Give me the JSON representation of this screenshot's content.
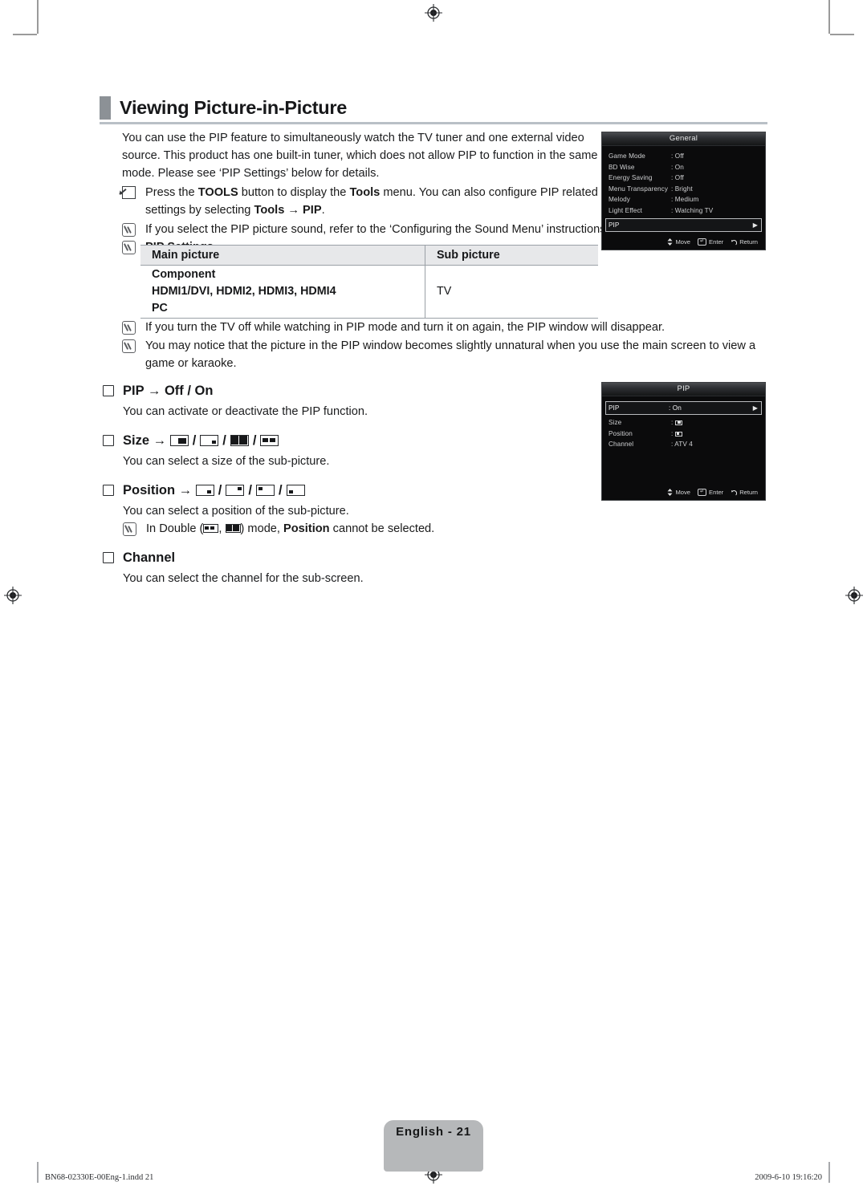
{
  "page": {
    "heading": "Viewing Picture-in-Picture",
    "footer_left": "BN68-02330E-00Eng-1.indd   21",
    "footer_right": "2009-6-10   19:16:20",
    "page_tab": "English - 21",
    "accent_bar_color": "#8c9196",
    "rule_color": "#b9c0c6"
  },
  "intro": {
    "paragraph": "You can use the PIP feature to simultaneously watch the TV tuner and one external video source. This product has one built-in tuner, which does not allow PIP to function in the same mode. Please see ‘PIP Settings’ below for details.",
    "tools_note_a": "Press the ",
    "tools_note_bold1": "TOOLS",
    "tools_note_b": " button to display the ",
    "tools_note_bold2": "Tools",
    "tools_note_c": " menu. You can also configure PIP related settings by selecting ",
    "tools_note_bold3": "Tools",
    "tools_note_arrow": " → ",
    "tools_note_bold4": "PIP",
    "tools_note_d": ".",
    "sound_note": "If you select the PIP picture sound, refer to the ‘Configuring the Sound Menu’ instructions.",
    "settings_note": "PIP Settings"
  },
  "pip_table": {
    "headers": [
      "Main picture",
      "Sub picture"
    ],
    "main_rows": [
      "Component",
      "HDMI1/DVI, HDMI2, HDMI3, HDMI4",
      "PC"
    ],
    "sub_value": "TV"
  },
  "post_table_notes": [
    "If you turn the TV off while watching in PIP mode and turn it on again, the PIP window will disappear.",
    "You may notice that the picture in the PIP window becomes slightly unnatural when you use the main screen to view a game or karaoke."
  ],
  "options": {
    "pip": {
      "title_a": "PIP",
      "title_arrow": " → ",
      "title_b": "Off / On",
      "desc": "You can activate or deactivate the PIP function."
    },
    "size": {
      "title": "Size",
      "title_arrow": " → ",
      "desc": "You can select a size of the sub-picture.",
      "glyph_names": [
        "size-large-icon",
        "size-small-icon",
        "size-double-wide-icon",
        "size-double-narrow-icon"
      ],
      "separator": "/"
    },
    "position": {
      "title": "Position",
      "title_arrow": " → ",
      "desc": "You can select a position of the sub-picture.",
      "glyph_names": [
        "position-bottom-right-icon",
        "position-top-right-icon",
        "position-top-left-icon",
        "position-bottom-left-icon"
      ],
      "separator": "/",
      "note_a": "In Double (",
      "note_comma": ", ",
      "note_b": ") mode, ",
      "note_bold": "Position",
      "note_c": " cannot be selected."
    },
    "channel": {
      "title": "Channel",
      "desc": "You can select the channel for the sub-screen."
    }
  },
  "osd_general": {
    "title": "General",
    "rows": [
      {
        "label": "Game Mode",
        "value": ": Off"
      },
      {
        "label": "BD Wise",
        "value": ": On"
      },
      {
        "label": "Energy Saving",
        "value": ": Off"
      },
      {
        "label": "Menu Transparency",
        "value": ": Bright"
      },
      {
        "label": "Melody",
        "value": ": Medium"
      },
      {
        "label": "Light Effect",
        "value": ": Watching TV"
      }
    ],
    "selected_row": {
      "label": "PIP",
      "value": "",
      "arrow": "▶"
    },
    "footer": {
      "move": "Move",
      "enter": "Enter",
      "return": "Return",
      "enter_key": "↵"
    }
  },
  "osd_pip": {
    "title": "PIP",
    "selected_row": {
      "label": "PIP",
      "value": ": On",
      "arrow": "▶"
    },
    "rows": [
      {
        "label": "Size",
        "value": ":",
        "glyph": "size-large-icon"
      },
      {
        "label": "Position",
        "value": ":",
        "glyph": "position-bottom-left-icon"
      },
      {
        "label": "Channel",
        "value": ": ATV 4",
        "glyph": ""
      }
    ],
    "footer": {
      "move": "Move",
      "enter": "Enter",
      "return": "Return",
      "enter_key": "↵"
    }
  }
}
